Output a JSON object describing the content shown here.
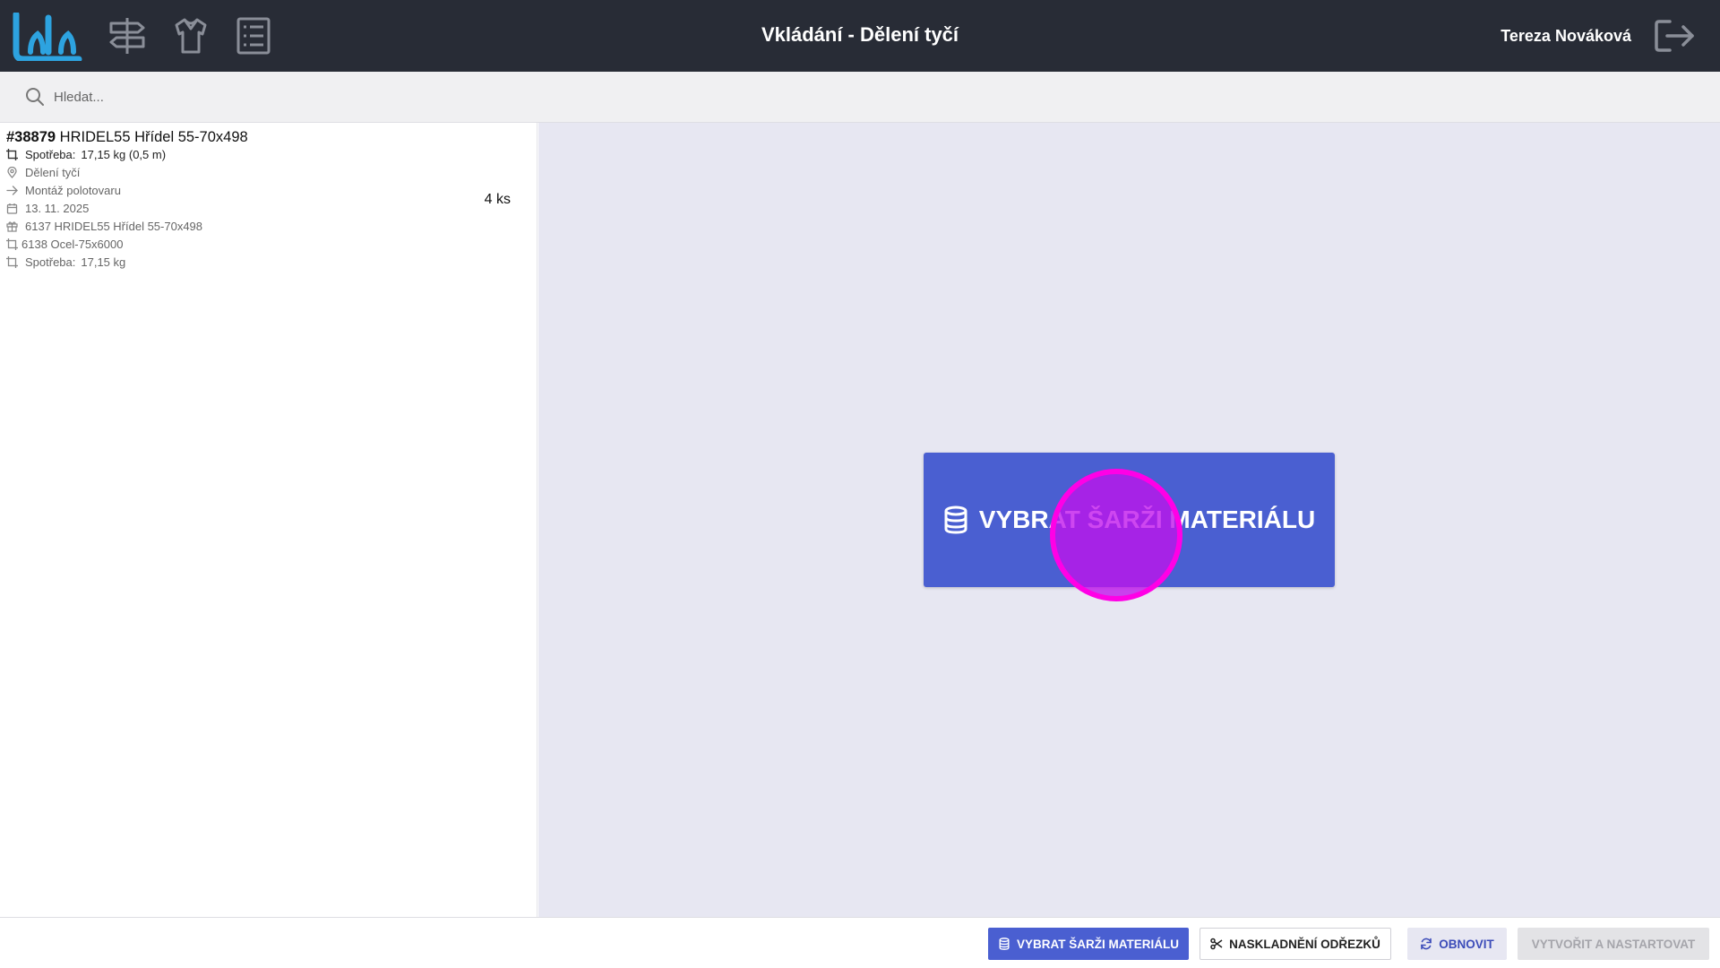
{
  "app": {
    "title": "Vkládání - Dělení tyčí",
    "user_name": "Tereza Nováková",
    "accent_color": "#4a5fd1",
    "header_color": "#282c36",
    "logo_color": "#2da3e0"
  },
  "nav": {
    "icons": [
      "signpost-icon",
      "shirt-icon",
      "checklist-icon"
    ]
  },
  "search": {
    "placeholder": "Hledat..."
  },
  "order": {
    "number": "#38879",
    "name": "HRIDEL55 Hřídel 55-70x498",
    "quantity": "4 ks",
    "consumption_label": "Spotřeba:",
    "consumption_value": "17,15 kg (0,5 m)",
    "operation": "Dělení tyčí",
    "next_operation": "Montáž polotovaru",
    "date": "13. 11. 2025",
    "product": "6137 HRIDEL55 Hřídel 55-70x498",
    "material": "6138 Ocel-75x6000",
    "material_consumption_label": "Spotřeba:",
    "material_consumption_value": "17,15 kg"
  },
  "main": {
    "select_batch_label": "VYBRAT ŠARŽI MATERIÁLU"
  },
  "footer": {
    "select_batch_label": "VYBRAT ŠARŽI MATERIÁLU",
    "store_offcuts_label": "NASKLADNĚNÍ ODŘEZKŮ",
    "refresh_label": "OBNOVIT",
    "create_start_label": "VYTVOŘIT A NASTARTOVAT"
  }
}
